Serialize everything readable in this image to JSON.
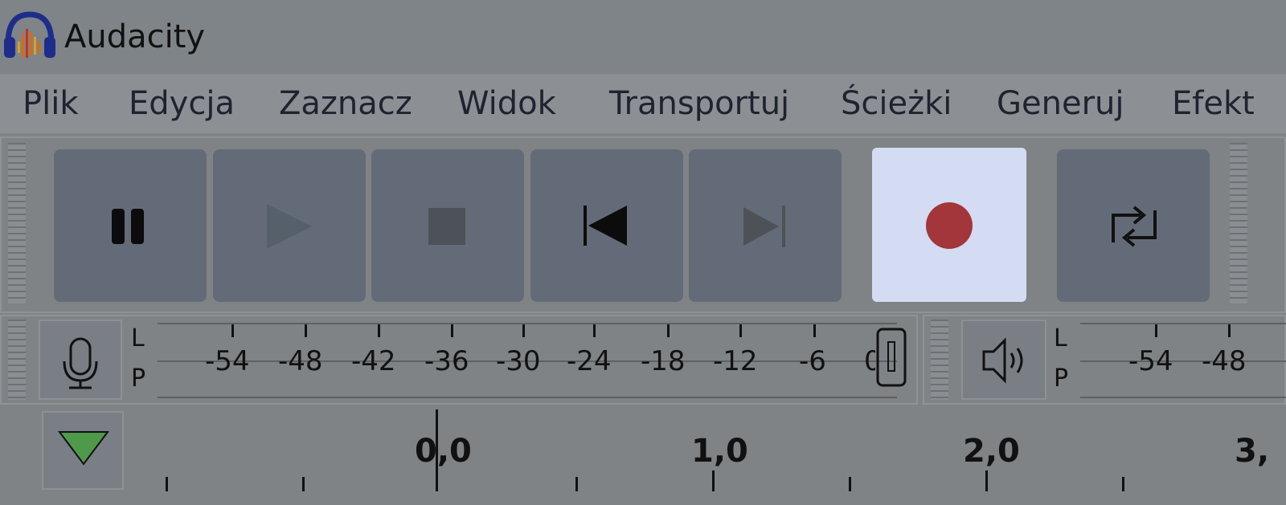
{
  "window": {
    "title": "Audacity",
    "logo_icon": "audacity-headphones-icon"
  },
  "menu": [
    {
      "id": "plik",
      "label": "Plik"
    },
    {
      "id": "edycja",
      "label": "Edycja"
    },
    {
      "id": "zaznacz",
      "label": "Zaznacz"
    },
    {
      "id": "widok",
      "label": "Widok"
    },
    {
      "id": "transportuj",
      "label": "Transportuj"
    },
    {
      "id": "sciezki",
      "label": "Ścieżki"
    },
    {
      "id": "generuj",
      "label": "Generuj"
    },
    {
      "id": "efekt",
      "label": "Efekt"
    }
  ],
  "transport": {
    "buttons": [
      {
        "id": "pause",
        "icon": "pause-icon"
      },
      {
        "id": "play",
        "icon": "play-icon"
      },
      {
        "id": "stop",
        "icon": "stop-icon"
      },
      {
        "id": "skip-start",
        "icon": "skip-to-start-icon"
      },
      {
        "id": "skip-end",
        "icon": "skip-to-end-icon"
      },
      {
        "id": "record",
        "icon": "record-icon",
        "highlighted": true
      },
      {
        "id": "loop",
        "icon": "loop-icon"
      }
    ],
    "record_color": "#a3363a",
    "highlight_color": "#d3dcf2"
  },
  "recording_meter": {
    "icon": "microphone-icon",
    "channel_top": "L",
    "channel_bottom": "P",
    "scale": [
      "-54",
      "-48",
      "-42",
      "-36",
      "-30",
      "-24",
      "-18",
      "-12",
      "-6",
      "0"
    ]
  },
  "playback_meter": {
    "icon": "speaker-icon",
    "channel_top": "L",
    "channel_bottom": "P",
    "scale": [
      "-54",
      "-48"
    ]
  },
  "timeline": {
    "labels": [
      "0,0",
      "1,0",
      "2,0",
      "3,"
    ],
    "play_indicator_icon": "play-head-triangle-icon",
    "play_indicator_color": "#4f9a4a"
  }
}
